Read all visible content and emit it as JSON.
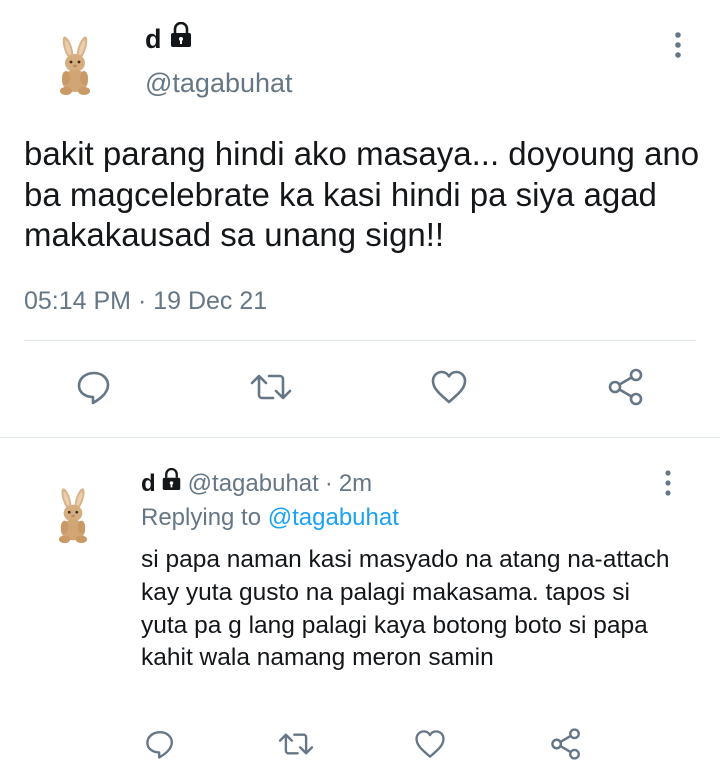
{
  "main_tweet": {
    "display_name": "d",
    "lock_icon": "lock-icon",
    "handle": "@tagabuhat",
    "text": "bakit parang hindi ako masaya... doyoung ano ba magcelebrate ka kasi hindi pa siya agad makakausad sa unang sign!!",
    "timestamp": "05:14 PM · 19 Dec 21",
    "actions": [
      "reply-icon",
      "retweet-icon",
      "like-icon",
      "share-icon"
    ]
  },
  "reply_tweet": {
    "display_name": "d",
    "handle": "@tagabuhat",
    "separator": "·",
    "time": "2m",
    "replying_to_label": "Replying to",
    "replying_to_handle": "@tagabuhat",
    "text": "si papa naman kasi masyado na atang na-attach kay yuta gusto na palagi makasama. tapos si yuta pa g lang palagi kaya botong boto si papa kahit wala namang meron samin",
    "actions": [
      "reply-icon",
      "retweet-icon",
      "like-icon",
      "share-icon"
    ]
  },
  "colors": {
    "text_primary": "#14171a",
    "text_secondary": "#657786",
    "link": "#1da1f2",
    "icon": "#657786",
    "divider": "#e1e8ed"
  }
}
